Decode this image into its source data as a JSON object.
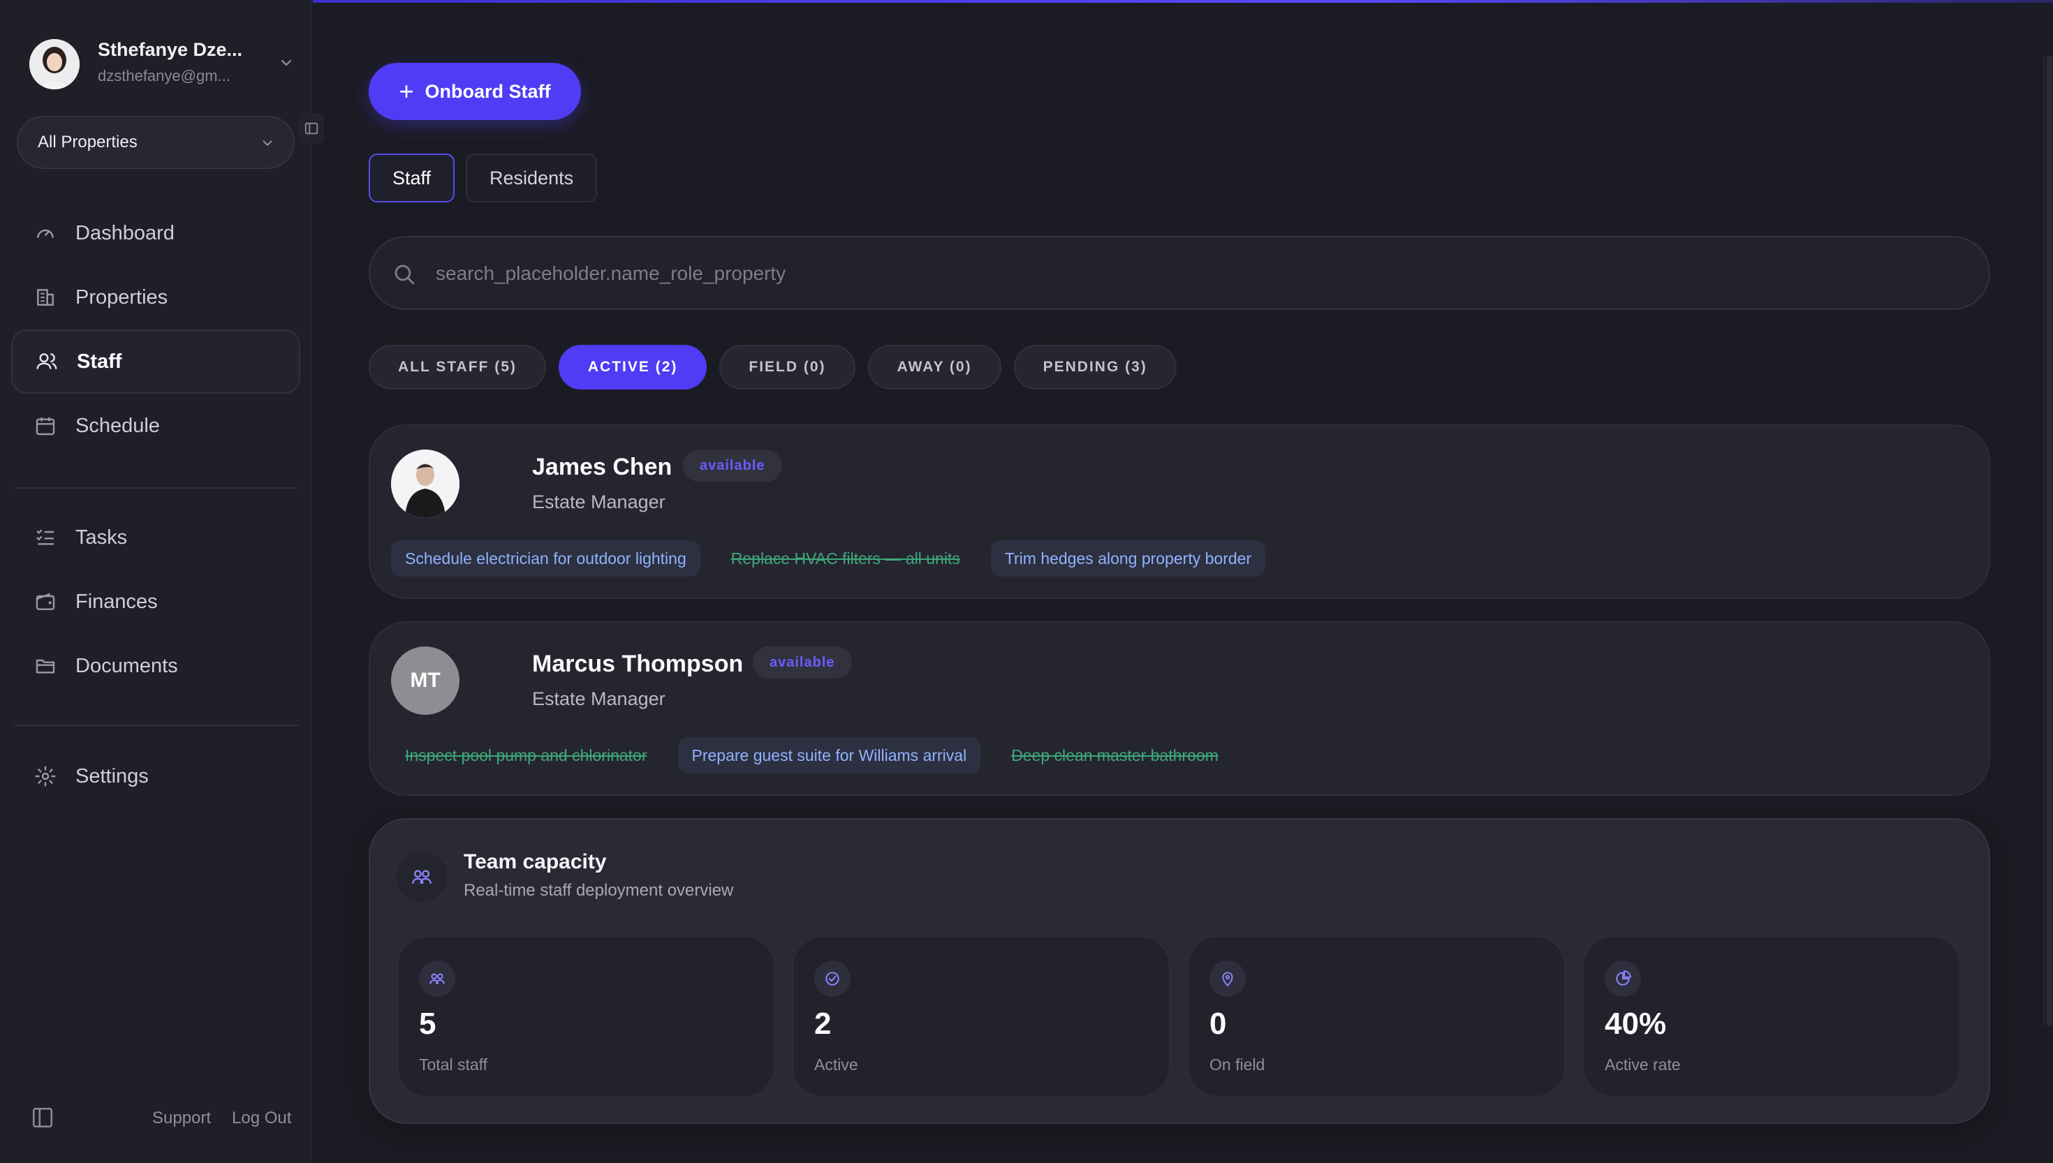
{
  "user": {
    "name": "Sthefanye Dze...",
    "email": "dzsthefanye@gm..."
  },
  "property_select": {
    "value": "All Properties"
  },
  "nav": {
    "items": [
      {
        "label": "Dashboard",
        "icon": "gauge-icon"
      },
      {
        "label": "Properties",
        "icon": "building-icon"
      },
      {
        "label": "Staff",
        "icon": "users-icon",
        "active": true
      },
      {
        "label": "Schedule",
        "icon": "calendar-icon"
      },
      {
        "label": "Tasks",
        "icon": "checklist-icon"
      },
      {
        "label": "Finances",
        "icon": "wallet-icon"
      },
      {
        "label": "Documents",
        "icon": "folder-icon"
      },
      {
        "label": "Settings",
        "icon": "gear-icon"
      }
    ]
  },
  "footer": {
    "support": "Support",
    "logout": "Log Out"
  },
  "toolbar": {
    "onboard_label": "Onboard Staff"
  },
  "tabs": [
    {
      "label": "Staff",
      "active": true
    },
    {
      "label": "Residents"
    }
  ],
  "search": {
    "placeholder": "search_placeholder.name_role_property",
    "value": ""
  },
  "filters": [
    {
      "label": "ALL STAFF (5)"
    },
    {
      "label": "ACTIVE (2)",
      "active": true
    },
    {
      "label": "FIELD (0)"
    },
    {
      "label": "AWAY (0)"
    },
    {
      "label": "PENDING (3)"
    }
  ],
  "staff": [
    {
      "name": "James Chen",
      "status": "available",
      "role": "Estate Manager",
      "tasks": [
        {
          "label": "Schedule electrician for outdoor lighting",
          "done": false
        },
        {
          "label": "Replace HVAC filters — all units",
          "done": true
        },
        {
          "label": "Trim hedges along property border",
          "done": false
        }
      ]
    },
    {
      "name": "Marcus Thompson",
      "initials": "MT",
      "status": "available",
      "role": "Estate Manager",
      "tasks": [
        {
          "label": "Inspect pool pump and chlorinator",
          "done": true
        },
        {
          "label": "Prepare guest suite for Williams arrival",
          "done": false
        },
        {
          "label": "Deep clean master bathroom",
          "done": true
        }
      ]
    }
  ],
  "capacity": {
    "title": "Team capacity",
    "subtitle": "Real-time staff deployment overview",
    "stats": [
      {
        "value": "5",
        "label": "Total staff",
        "icon": "users-icon"
      },
      {
        "value": "2",
        "label": "Active",
        "icon": "check-circle-icon"
      },
      {
        "value": "0",
        "label": "On field",
        "icon": "map-pin-icon"
      },
      {
        "value": "40%",
        "label": "Active rate",
        "icon": "pie-chart-icon"
      }
    ]
  },
  "colors": {
    "accent": "#4f3cf4",
    "badge_text": "#6d5cff",
    "task_text": "#8fb3ff",
    "done_text": "#3ea87a"
  }
}
